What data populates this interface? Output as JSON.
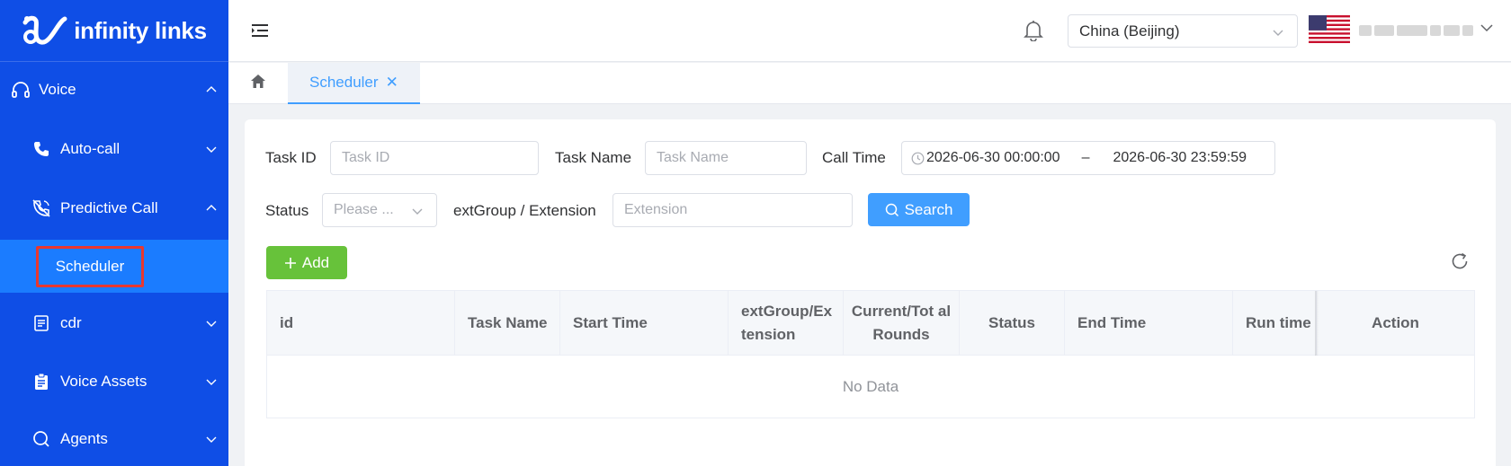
{
  "app": {
    "logo_text": "infinity links"
  },
  "sidebar": {
    "items": [
      {
        "label": "Voice",
        "icon": "headphones-icon",
        "expanded": true
      },
      {
        "label": "Auto-call",
        "icon": "phone-icon",
        "expanded": false
      },
      {
        "label": "Predictive Call",
        "icon": "phone-slash-icon",
        "expanded": true
      },
      {
        "label": "Scheduler",
        "icon": "",
        "active": true
      },
      {
        "label": "cdr",
        "icon": "document-icon",
        "expanded": false
      },
      {
        "label": "Voice Assets",
        "icon": "clipboard-icon",
        "expanded": false
      },
      {
        "label": "Agents",
        "icon": "search-icon",
        "expanded": false
      }
    ]
  },
  "header": {
    "region": "China (Beijing)"
  },
  "tabs": {
    "active": "Scheduler"
  },
  "filters": {
    "task_id_label": "Task ID",
    "task_id_placeholder": "Task ID",
    "task_name_label": "Task Name",
    "task_name_placeholder": "Task Name",
    "call_time_label": "Call Time",
    "call_time_start": "2026-06-30 00:00:00",
    "call_time_sep": "–",
    "call_time_end": "2026-06-30 23:59:59",
    "status_label": "Status",
    "status_placeholder": "Please ...",
    "ext_label": "extGroup / Extension",
    "ext_placeholder": "Extension",
    "search_label": "Search"
  },
  "toolbar": {
    "add_label": "Add"
  },
  "table": {
    "columns": [
      "id",
      "Task Name",
      "Start Time",
      "extGroup/Ex tension",
      "Current/Tot al Rounds",
      "Status",
      "End Time",
      "Run time",
      "Action"
    ],
    "empty_text": "No Data"
  },
  "colors": {
    "sidebar_bg": "#0f4ee6",
    "sidebar_active": "#1b7cff",
    "primary": "#409eff",
    "success": "#67c23a",
    "highlight_border": "#e8382f"
  }
}
